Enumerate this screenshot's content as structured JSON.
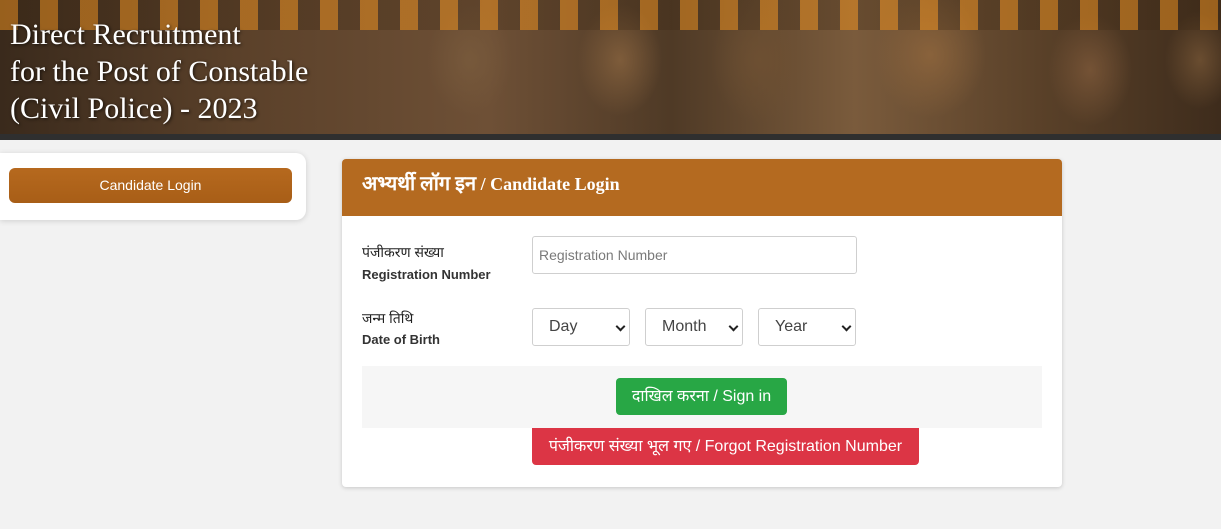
{
  "banner": {
    "title_line1": "Direct Recruitment",
    "title_line2": "for the Post of Constable",
    "title_line3": "(Civil Police) - 2023"
  },
  "sidebar": {
    "candidate_login_label": "Candidate Login"
  },
  "login": {
    "header_hi": "अभ्यर्थी लॉग इन",
    "header_en": " / Candidate Login",
    "registration": {
      "label_hi": "पंजीकरण संख्या",
      "label_en": "Registration Number",
      "placeholder": "Registration Number",
      "value": ""
    },
    "dob": {
      "label_hi": "जन्म तिथि",
      "label_en": "Date of Birth",
      "day": "Day",
      "month": "Month",
      "year": "Year"
    },
    "signin_label": "दाखिल करना / Sign in",
    "forgot_label": "पंजीकरण संख्या भूल गए / Forgot Registration Number"
  },
  "colors": {
    "brand": "#b46a20",
    "signin": "#28a745",
    "forgot": "#dc3545"
  },
  "icons": [
    "chevron-down-icon"
  ]
}
